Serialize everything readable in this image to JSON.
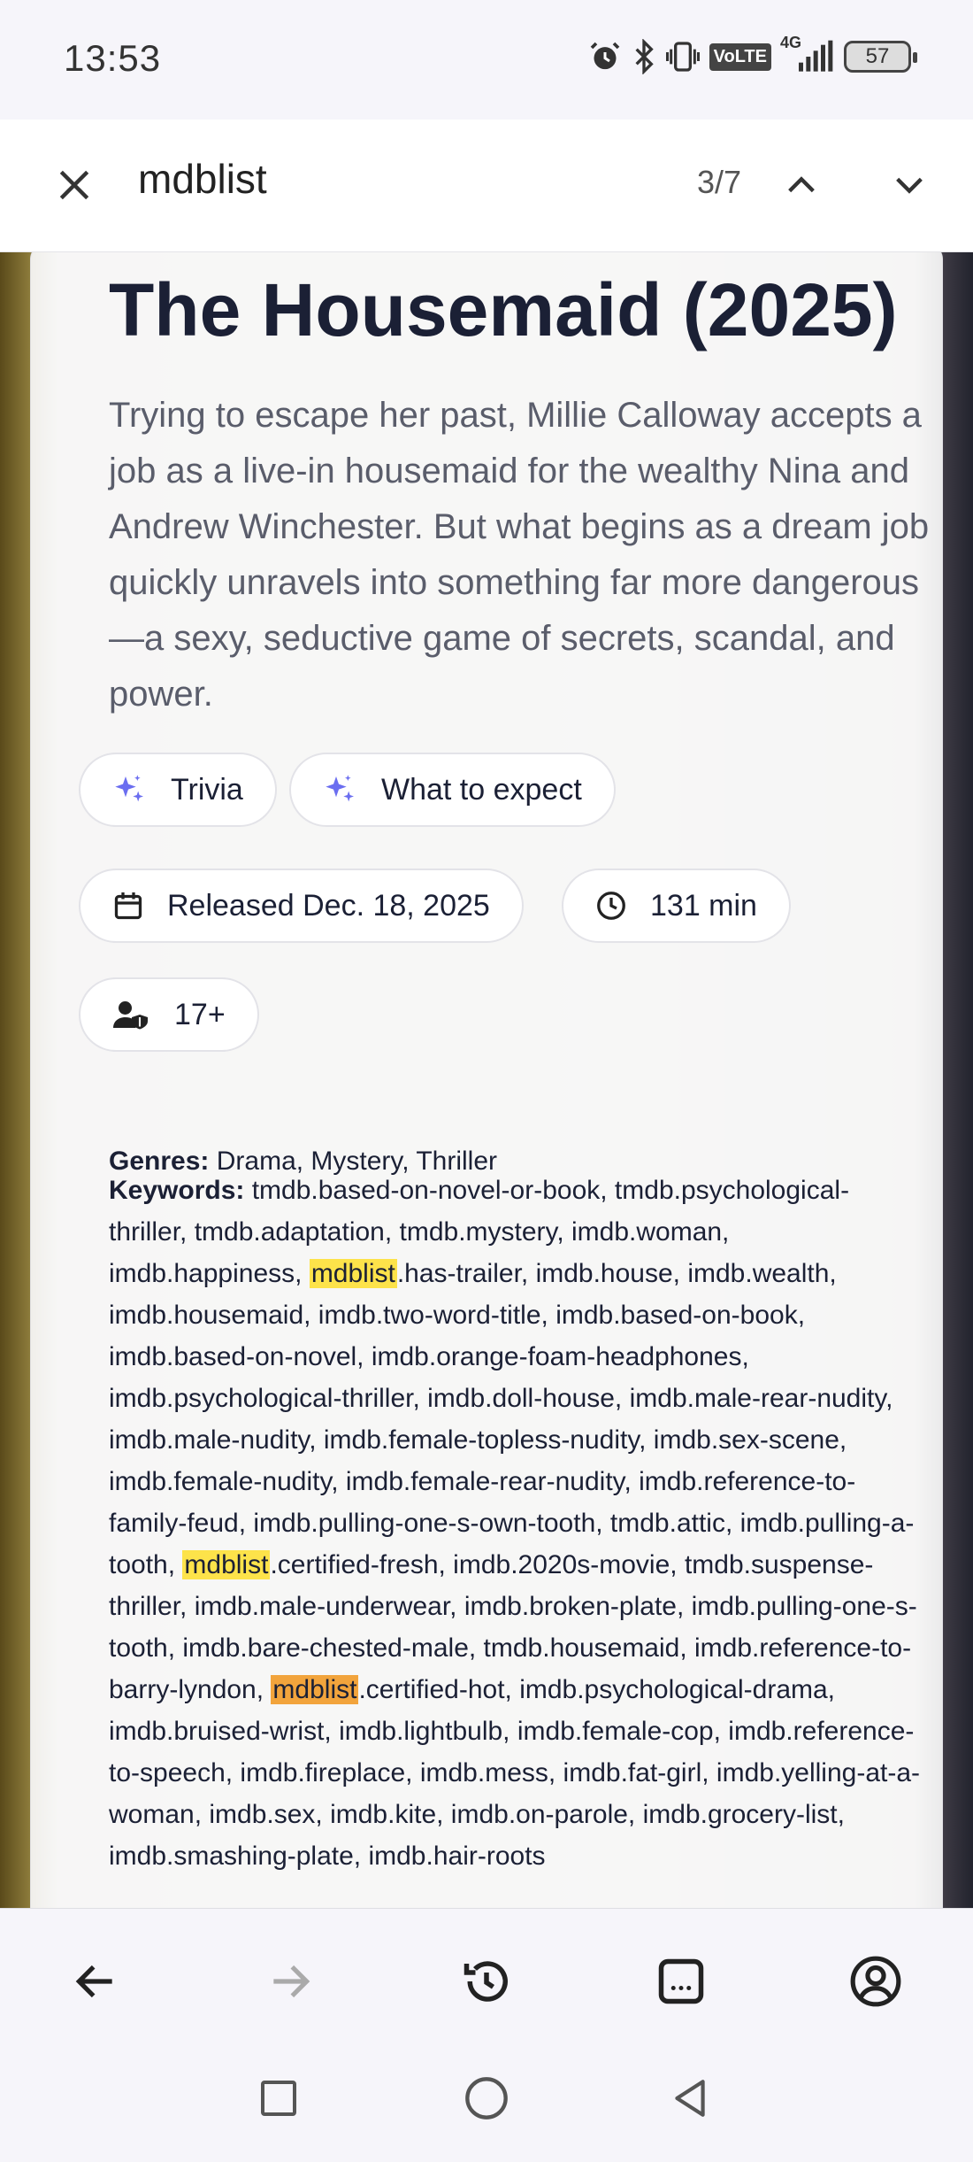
{
  "status_bar": {
    "time": "13:53",
    "network": "4G",
    "volte": "VoLTE",
    "battery": "57"
  },
  "find_bar": {
    "query": "mdblist",
    "match_count": "3/7"
  },
  "movie": {
    "title": "The Housemaid (2025)",
    "overview": "Trying to escape her past, Millie Calloway accepts a job as a live-in housemaid for the wealthy Nina and Andrew Winchester. But what begins as a dream job quickly unravels into something far more dangerous—a sexy, seductive game of secrets, scandal, and power.",
    "chips": {
      "trivia": "Trivia",
      "what_to_expect": "What to expect",
      "released": "Released Dec. 18, 2025",
      "runtime": "131 min",
      "rating": "17+"
    },
    "genres_label": "Genres:",
    "genres": "Drama, Mystery, Thriller",
    "keywords_label": "Keywords:",
    "keywords_seg1": "tmdb.based-on-novel-or-book, tmdb.psychological-thriller, tmdb.adaptation, tmdb.mystery, imdb.woman, imdb.happiness, ",
    "highlight1": "mdblist",
    "keywords_seg2": ".has-trailer, imdb.house, imdb.wealth, imdb.housemaid, imdb.two-word-title, imdb.based-on-book, imdb.based-on-novel, imdb.orange-foam-headphones, imdb.psychological-thriller, imdb.doll-house, imdb.male-rear-nudity, imdb.male-nudity, imdb.female-topless-nudity, imdb.sex-scene, imdb.female-nudity, imdb.female-rear-nudity, imdb.reference-to-family-feud, imdb.pulling-one-s-own-tooth, tmdb.attic, imdb.pulling-a-tooth, ",
    "highlight2": "mdblist",
    "keywords_seg3": ".certified-fresh, imdb.2020s-movie, tmdb.suspense-thriller, imdb.male-underwear, imdb.broken-plate, imdb.pulling-one-s-tooth, imdb.bare-chested-male, tmdb.housemaid, imdb.reference-to-barry-lyndon, ",
    "highlight3": "mdblist",
    "keywords_seg4": ".certified-hot, imdb.psychological-drama, imdb.bruised-wrist, imdb.lightbulb, imdb.female-cop, imdb.reference-to-speech, imdb.fireplace, imdb.mess, imdb.fat-girl, imdb.yelling-at-a-woman, imdb.sex, imdb.kite, imdb.on-parole, imdb.grocery-list, imdb.smashing-plate, imdb.hair-roots"
  },
  "colors": {
    "title": "#1b2035",
    "sparkle": "#6b6ef0",
    "highlight": "#fde34a",
    "active_highlight": "#f2a43c"
  }
}
